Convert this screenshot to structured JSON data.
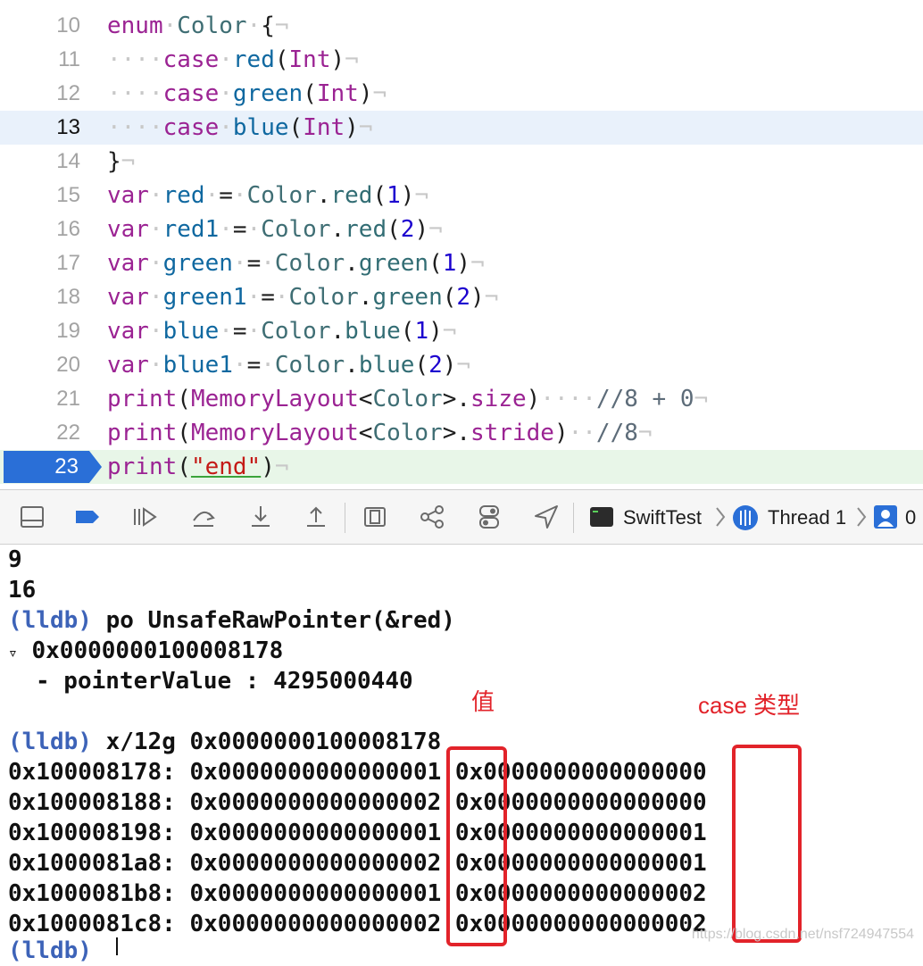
{
  "editor": {
    "lines": [
      {
        "num": "10"
      },
      {
        "num": "11"
      },
      {
        "num": "12"
      },
      {
        "num": "13"
      },
      {
        "num": "14"
      },
      {
        "num": "15"
      },
      {
        "num": "16"
      },
      {
        "num": "17"
      },
      {
        "num": "18"
      },
      {
        "num": "19"
      },
      {
        "num": "20"
      },
      {
        "num": "21"
      },
      {
        "num": "22"
      },
      {
        "num": "23"
      }
    ],
    "code": {
      "l10": [
        "enum",
        "Color",
        "{"
      ],
      "l11": [
        "case",
        "red",
        "Int"
      ],
      "l12": [
        "case",
        "green",
        "Int"
      ],
      "l13": [
        "case",
        "blue",
        "Int"
      ],
      "l14": [
        "}"
      ],
      "l15": [
        "var",
        "red",
        "Color",
        "red",
        "1"
      ],
      "l16": [
        "var",
        "red1",
        "Color",
        "red",
        "2"
      ],
      "l17": [
        "var",
        "green",
        "Color",
        "green",
        "1"
      ],
      "l18": [
        "var",
        "green1",
        "Color",
        "green",
        "2"
      ],
      "l19": [
        "var",
        "blue",
        "Color",
        "blue",
        "1"
      ],
      "l20": [
        "var",
        "blue1",
        "Color",
        "blue",
        "2"
      ],
      "l21": [
        "print",
        "MemoryLayout",
        "Color",
        "size",
        "//8 + 0"
      ],
      "l22": [
        "print",
        "MemoryLayout",
        "Color",
        "stride",
        "//8"
      ],
      "l23": [
        "print",
        "\"end\""
      ]
    },
    "breakpoint_line": "23"
  },
  "toolbar": {
    "icons": [
      "panel-toggle-icon",
      "breakpoint-icon",
      "continue-icon",
      "step-over-icon",
      "step-into-icon",
      "step-out-icon",
      "view-hierarchy-icon",
      "memory-graph-icon",
      "environment-icon",
      "location-icon"
    ],
    "breadcrumb": {
      "target": "SwiftTest",
      "thread": "Thread 1",
      "frame": "0"
    }
  },
  "console": {
    "output": [
      "9",
      "16"
    ],
    "cmd1_prompt": "(lldb)",
    "cmd1": "po UnsafeRawPointer(&red)",
    "pointer": "0x0000000100008178",
    "pointer_value": "- pointerValue : 4295000440",
    "cmd2_prompt": "(lldb)",
    "cmd2": "x/12g 0x0000000100008178",
    "memory": [
      {
        "addr": "0x100008178:",
        "v1": "0x0000000000000001",
        "v2": "0x0000000000000000"
      },
      {
        "addr": "0x100008188:",
        "v1": "0x0000000000000002",
        "v2": "0x0000000000000000"
      },
      {
        "addr": "0x100008198:",
        "v1": "0x0000000000000001",
        "v2": "0x0000000000000001"
      },
      {
        "addr": "0x1000081a8:",
        "v1": "0x0000000000000002",
        "v2": "0x0000000000000001"
      },
      {
        "addr": "0x1000081b8:",
        "v1": "0x0000000000000001",
        "v2": "0x0000000000000002"
      },
      {
        "addr": "0x1000081c8:",
        "v1": "0x0000000000000002",
        "v2": "0x0000000000000002"
      }
    ],
    "last_prompt": "(lldb)"
  },
  "annotations": {
    "value_label": "值",
    "case_label": "case 类型"
  },
  "watermark": "https://blog.csdn.net/nsf724947554"
}
